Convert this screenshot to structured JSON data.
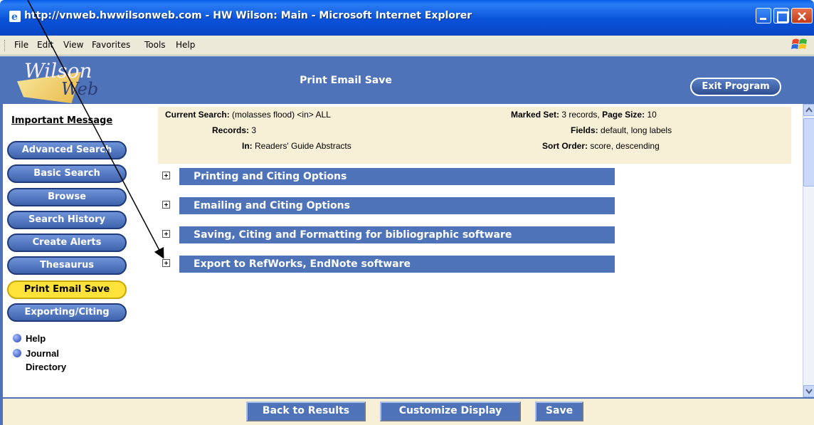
{
  "window": {
    "title": "http://vnweb.hwwilsonweb.com - HW Wilson: Main - Microsoft Internet Explorer",
    "icon": "ie-icon",
    "controls": [
      "minimize-icon",
      "maximize-icon",
      "close-icon"
    ]
  },
  "menubar": {
    "items": [
      "File",
      "Edit",
      "View",
      "Favorites",
      "Tools",
      "Help"
    ]
  },
  "header": {
    "logo_top": "Wilson",
    "logo_bottom": "Web",
    "page_heading": "Print Email Save",
    "exit_label": "Exit Program"
  },
  "sidebar": {
    "important": "Important Message",
    "nav": [
      "Advanced Search",
      "Basic Search",
      "Browse",
      "Search History",
      "Create Alerts",
      "Thesaurus",
      "Print Email Save",
      "Exporting/Citing"
    ],
    "active_index": 6,
    "links": [
      "Help",
      "Journal",
      "Directory"
    ]
  },
  "search_info": {
    "current_search_label": "Current Search:",
    "current_search_value": "(molasses flood) <in> ALL",
    "records_label": "Records:",
    "records_value": "3",
    "in_label": "In:",
    "in_value": "Readers' Guide Abstracts",
    "marked_set_label": "Marked Set:",
    "marked_set_value": "3 records,",
    "page_size_label": "Page Size:",
    "page_size_value": "10",
    "fields_label": "Fields:",
    "fields_value": "default, long labels",
    "sort_label": "Sort Order:",
    "sort_value": "score, descending"
  },
  "sections": [
    "Printing and Citing Options",
    "Emailing and Citing Options",
    "Saving, Citing and Formatting for bibliographic software",
    "Export to RefWorks, EndNote software"
  ],
  "footer": {
    "buttons": [
      "Back to Results",
      "Customize Display",
      "Save"
    ]
  },
  "colors": {
    "brand_blue": "#4f73b8",
    "info_bg": "#f8f0d6",
    "active_button": "#ffe23a"
  }
}
